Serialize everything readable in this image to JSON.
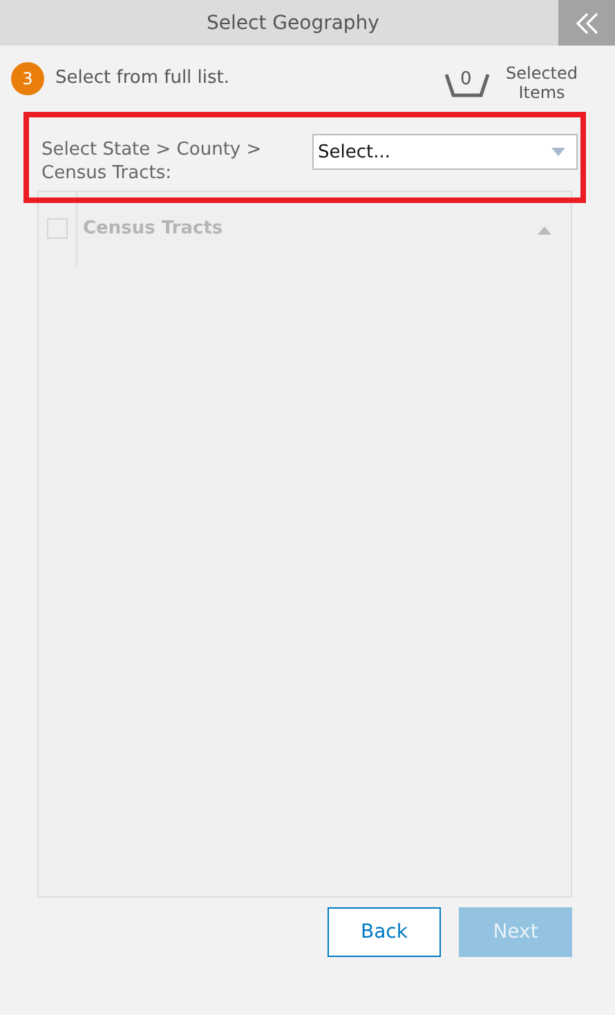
{
  "header": {
    "title": "Select Geography"
  },
  "step": {
    "number": "3",
    "text": "Select from full list."
  },
  "selected_items": {
    "count": "0",
    "label": "Selected Items"
  },
  "filter": {
    "label": "Select State > County > Census Tracts:",
    "placeholder": "Select...",
    "highlighted": true
  },
  "table": {
    "columns": [
      {
        "label": "Census Tracts",
        "checked": false
      }
    ]
  },
  "buttons": [
    {
      "label": "Back",
      "disabled": false
    },
    {
      "label": "Next",
      "disabled": true
    }
  ]
}
